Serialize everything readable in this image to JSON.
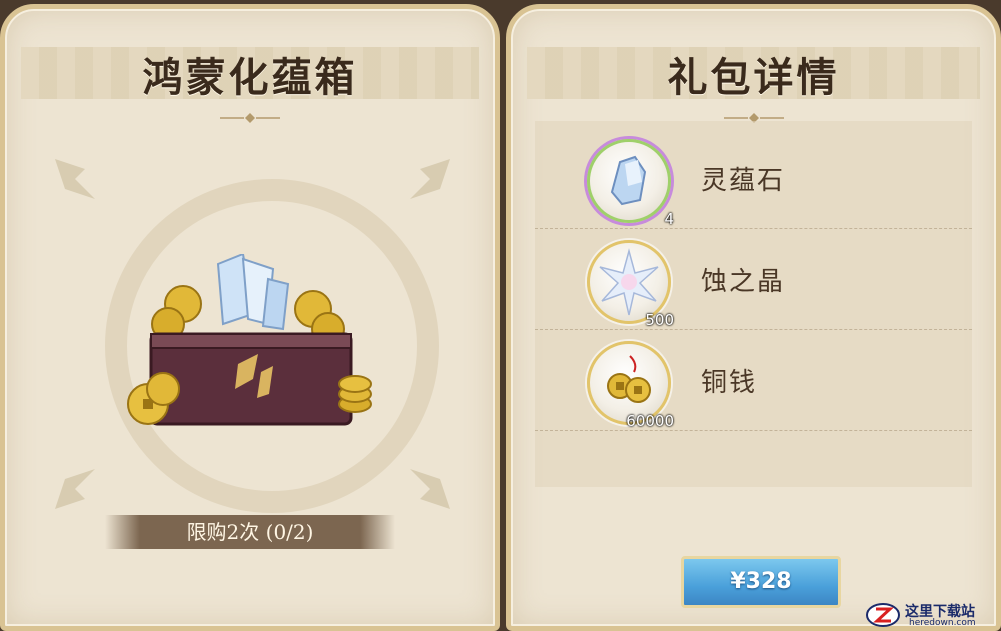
{
  "left_panel": {
    "title": "鸿蒙化蕴箱",
    "limit_text": "限购2次 (0/2)"
  },
  "right_panel": {
    "title": "礼包详情",
    "items": [
      {
        "name": "灵蕴石",
        "count": "4",
        "icon": "spirit-stone-icon"
      },
      {
        "name": "蚀之晶",
        "count": "500",
        "icon": "crystal-star-icon"
      },
      {
        "name": "铜钱",
        "count": "60000",
        "icon": "copper-coins-icon"
      }
    ],
    "price_label": "¥328"
  },
  "watermark": {
    "cn": "这里下载站",
    "en": "heredown.com"
  },
  "colors": {
    "panel_bg": "#ede4d2",
    "frame_gold": "#d9c393",
    "title_text": "#3a2a1c",
    "price_button": "#4aa0da",
    "limit_bar": "#7c6650"
  }
}
